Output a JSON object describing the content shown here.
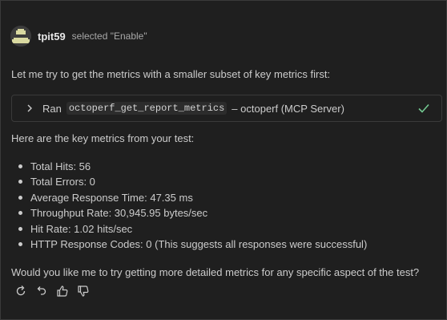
{
  "header": {
    "username": "tpit59",
    "action": "selected \"Enable\""
  },
  "message": {
    "intro": "Let me try to get the metrics with a smaller subset of key metrics first:",
    "tool_call": {
      "ran_label": "Ran",
      "tool_name": "octoperf_get_report_metrics",
      "source": "– octoperf (MCP Server)",
      "status_icon": "check-icon",
      "status_color": "#73c991"
    },
    "metrics_intro": "Here are the key metrics from your test:",
    "metrics": [
      "Total Hits: 56",
      "Total Errors: 0",
      "Average Response Time: 47.35 ms",
      "Throughput Rate: 30,945.95 bytes/sec",
      "Hit Rate: 1.02 hits/sec",
      "HTTP Response Codes: 0 (This suggests all responses were successful)"
    ],
    "question": "Would you like me to try getting more detailed metrics for any specific aspect of the test?"
  },
  "actions": [
    "retry-icon",
    "undo-icon",
    "thumbs-up-icon",
    "thumbs-down-icon"
  ]
}
